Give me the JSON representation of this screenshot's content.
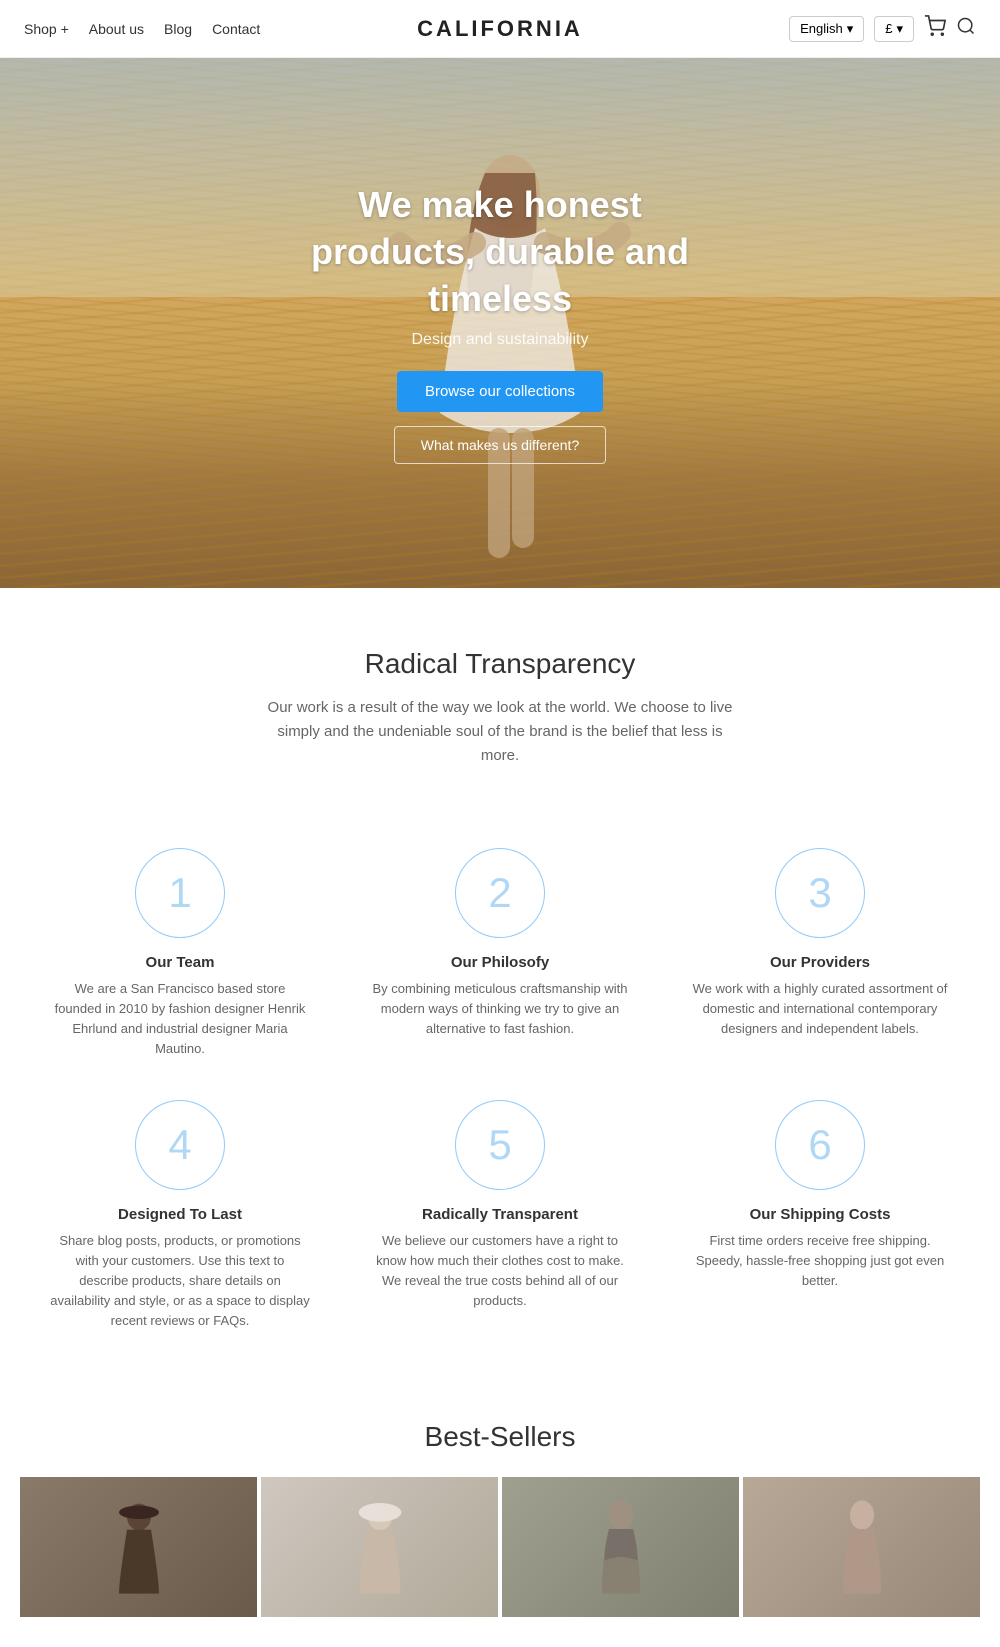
{
  "nav": {
    "brand": "CALIFORNIA",
    "links": [
      {
        "label": "Shop +",
        "id": "shop"
      },
      {
        "label": "About us",
        "id": "about"
      },
      {
        "label": "Blog",
        "id": "blog"
      },
      {
        "label": "Contact",
        "id": "contact"
      }
    ],
    "language": "English",
    "currency": "£",
    "chevron": "▾"
  },
  "hero": {
    "title": "We make honest products, durable and timeless",
    "subtitle": "Design and sustainability",
    "btn_primary": "Browse our collections",
    "btn_outline": "What makes us different?"
  },
  "transparency": {
    "heading": "Radical Transparency",
    "body": "Our work is a result of the way we look at the world. We choose to live simply and the undeniable soul of the brand is the belief that less is more."
  },
  "features": [
    {
      "number": "1",
      "title": "Our Team",
      "body": "We are a San Francisco based store founded in 2010 by fashion designer Henrik Ehrlund and industrial designer Maria Mautino."
    },
    {
      "number": "2",
      "title": "Our Philosofy",
      "body": "By combining meticulous craftsmanship with modern ways of thinking we try to give an alternative to fast fashion."
    },
    {
      "number": "3",
      "title": "Our Providers",
      "body": "We work with a highly curated assortment of domestic and international contemporary designers and independent labels."
    },
    {
      "number": "4",
      "title": "Designed To Last",
      "body": "Share blog posts, products, or promotions with your customers. Use this text to describe products, share details on availability and style, or as a space to display recent reviews or FAQs."
    },
    {
      "number": "5",
      "title": "Radically Transparent",
      "body": "We believe our customers have a right to know how much their clothes cost to make. We reveal the true costs behind all of our products."
    },
    {
      "number": "6",
      "title": "Our Shipping Costs",
      "body": "First time orders receive free shipping. Speedy, hassle-free shopping just got even better."
    }
  ],
  "bestsellers": {
    "heading": "Best-Sellers"
  }
}
